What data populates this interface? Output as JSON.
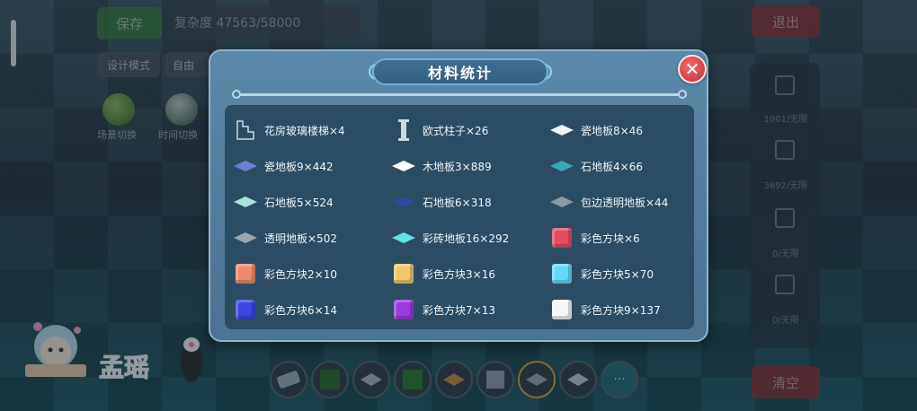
{
  "top": {
    "save_label": "保存",
    "complexity_text": "复杂度 47563/58000",
    "exit_label": "退出",
    "design_mode_label": "设计模式",
    "free_label": "自由"
  },
  "left": {
    "scene_switch_label": "场景切换",
    "time_switch_label": "时间切换"
  },
  "right_panel": {
    "counter1": "1001/无限",
    "counter2": "3692/无限",
    "counter3": "0/无限",
    "counter4": "0/无限",
    "clear_label": "清空"
  },
  "toolbar": {
    "more_label": "···"
  },
  "streamer": {
    "name": "孟瑶"
  },
  "dialog": {
    "title": "材料统计",
    "close_label": "✕",
    "items": [
      {
        "label": "花房玻璃楼梯×4",
        "icon": "stairs-icon",
        "color": "#cfd8de"
      },
      {
        "label": "欧式柱子×26",
        "icon": "pillar-icon",
        "color": "#cfd8de"
      },
      {
        "label": "瓷地板8×46",
        "icon": "tile-icon",
        "color": "#f4f4f4"
      },
      {
        "label": "瓷地板9×442",
        "icon": "tile-icon",
        "color": "#6f7fd6"
      },
      {
        "label": "木地板3×889",
        "icon": "tile-icon",
        "color": "#ffffff"
      },
      {
        "label": "石地板4×66",
        "icon": "tile-icon",
        "color": "#3aa7b6"
      },
      {
        "label": "石地板5×524",
        "icon": "tile-icon",
        "color": "#a6e6da"
      },
      {
        "label": "石地板6×318",
        "icon": "tile-icon",
        "color": "#2e4a9a"
      },
      {
        "label": "包边透明地板×44",
        "icon": "tile-icon",
        "color": "#8d9aa2"
      },
      {
        "label": "透明地板×502",
        "icon": "tile-icon",
        "color": "#9aa6ae"
      },
      {
        "label": "彩砖地板16×292",
        "icon": "tile-icon",
        "color": "#5ee3e6"
      },
      {
        "label": "彩色方块×6",
        "icon": "cube-icon",
        "color": "#e64b64"
      },
      {
        "label": "彩色方块2×10",
        "icon": "cube-icon",
        "color": "#ee8a6a"
      },
      {
        "label": "彩色方块3×16",
        "icon": "cube-icon",
        "color": "#f0c86a"
      },
      {
        "label": "彩色方块5×70",
        "icon": "cube-icon",
        "color": "#62d8f4"
      },
      {
        "label": "彩色方块6×14",
        "icon": "cube-icon",
        "color": "#3c46e0"
      },
      {
        "label": "彩色方块7×13",
        "icon": "cube-icon",
        "color": "#9a3ae0"
      },
      {
        "label": "彩色方块9×137",
        "icon": "cube-icon",
        "color": "#f4f6f8"
      }
    ]
  }
}
